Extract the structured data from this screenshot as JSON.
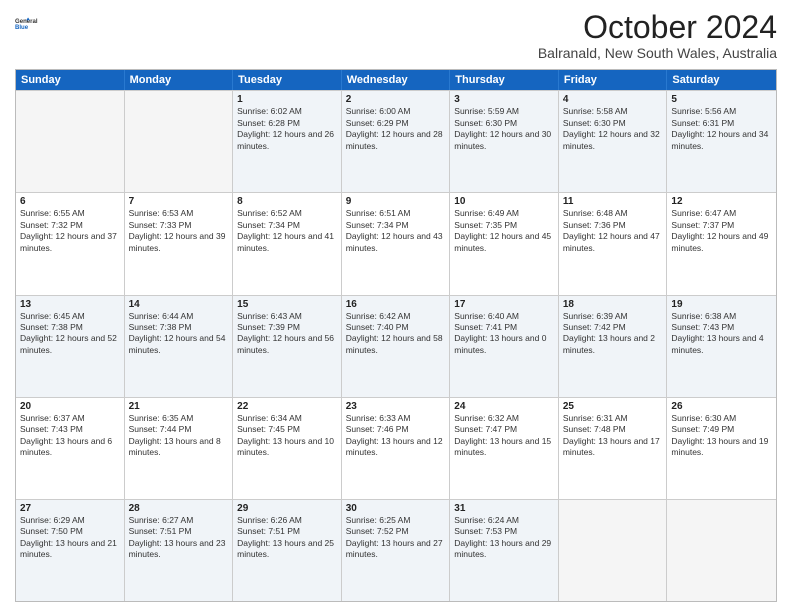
{
  "header": {
    "logo_line1": "General",
    "logo_line2": "Blue",
    "title": "October 2024",
    "subtitle": "Balranald, New South Wales, Australia"
  },
  "days": [
    "Sunday",
    "Monday",
    "Tuesday",
    "Wednesday",
    "Thursday",
    "Friday",
    "Saturday"
  ],
  "weeks": [
    [
      {
        "day": "",
        "sunrise": "",
        "sunset": "",
        "daylight": "",
        "empty": true
      },
      {
        "day": "",
        "sunrise": "",
        "sunset": "",
        "daylight": "",
        "empty": true
      },
      {
        "day": "1",
        "sunrise": "Sunrise: 6:02 AM",
        "sunset": "Sunset: 6:28 PM",
        "daylight": "Daylight: 12 hours and 26 minutes."
      },
      {
        "day": "2",
        "sunrise": "Sunrise: 6:00 AM",
        "sunset": "Sunset: 6:29 PM",
        "daylight": "Daylight: 12 hours and 28 minutes."
      },
      {
        "day": "3",
        "sunrise": "Sunrise: 5:59 AM",
        "sunset": "Sunset: 6:30 PM",
        "daylight": "Daylight: 12 hours and 30 minutes."
      },
      {
        "day": "4",
        "sunrise": "Sunrise: 5:58 AM",
        "sunset": "Sunset: 6:30 PM",
        "daylight": "Daylight: 12 hours and 32 minutes."
      },
      {
        "day": "5",
        "sunrise": "Sunrise: 5:56 AM",
        "sunset": "Sunset: 6:31 PM",
        "daylight": "Daylight: 12 hours and 34 minutes."
      }
    ],
    [
      {
        "day": "6",
        "sunrise": "Sunrise: 6:55 AM",
        "sunset": "Sunset: 7:32 PM",
        "daylight": "Daylight: 12 hours and 37 minutes."
      },
      {
        "day": "7",
        "sunrise": "Sunrise: 6:53 AM",
        "sunset": "Sunset: 7:33 PM",
        "daylight": "Daylight: 12 hours and 39 minutes."
      },
      {
        "day": "8",
        "sunrise": "Sunrise: 6:52 AM",
        "sunset": "Sunset: 7:34 PM",
        "daylight": "Daylight: 12 hours and 41 minutes."
      },
      {
        "day": "9",
        "sunrise": "Sunrise: 6:51 AM",
        "sunset": "Sunset: 7:34 PM",
        "daylight": "Daylight: 12 hours and 43 minutes."
      },
      {
        "day": "10",
        "sunrise": "Sunrise: 6:49 AM",
        "sunset": "Sunset: 7:35 PM",
        "daylight": "Daylight: 12 hours and 45 minutes."
      },
      {
        "day": "11",
        "sunrise": "Sunrise: 6:48 AM",
        "sunset": "Sunset: 7:36 PM",
        "daylight": "Daylight: 12 hours and 47 minutes."
      },
      {
        "day": "12",
        "sunrise": "Sunrise: 6:47 AM",
        "sunset": "Sunset: 7:37 PM",
        "daylight": "Daylight: 12 hours and 49 minutes."
      }
    ],
    [
      {
        "day": "13",
        "sunrise": "Sunrise: 6:45 AM",
        "sunset": "Sunset: 7:38 PM",
        "daylight": "Daylight: 12 hours and 52 minutes."
      },
      {
        "day": "14",
        "sunrise": "Sunrise: 6:44 AM",
        "sunset": "Sunset: 7:38 PM",
        "daylight": "Daylight: 12 hours and 54 minutes."
      },
      {
        "day": "15",
        "sunrise": "Sunrise: 6:43 AM",
        "sunset": "Sunset: 7:39 PM",
        "daylight": "Daylight: 12 hours and 56 minutes."
      },
      {
        "day": "16",
        "sunrise": "Sunrise: 6:42 AM",
        "sunset": "Sunset: 7:40 PM",
        "daylight": "Daylight: 12 hours and 58 minutes."
      },
      {
        "day": "17",
        "sunrise": "Sunrise: 6:40 AM",
        "sunset": "Sunset: 7:41 PM",
        "daylight": "Daylight: 13 hours and 0 minutes."
      },
      {
        "day": "18",
        "sunrise": "Sunrise: 6:39 AM",
        "sunset": "Sunset: 7:42 PM",
        "daylight": "Daylight: 13 hours and 2 minutes."
      },
      {
        "day": "19",
        "sunrise": "Sunrise: 6:38 AM",
        "sunset": "Sunset: 7:43 PM",
        "daylight": "Daylight: 13 hours and 4 minutes."
      }
    ],
    [
      {
        "day": "20",
        "sunrise": "Sunrise: 6:37 AM",
        "sunset": "Sunset: 7:43 PM",
        "daylight": "Daylight: 13 hours and 6 minutes."
      },
      {
        "day": "21",
        "sunrise": "Sunrise: 6:35 AM",
        "sunset": "Sunset: 7:44 PM",
        "daylight": "Daylight: 13 hours and 8 minutes."
      },
      {
        "day": "22",
        "sunrise": "Sunrise: 6:34 AM",
        "sunset": "Sunset: 7:45 PM",
        "daylight": "Daylight: 13 hours and 10 minutes."
      },
      {
        "day": "23",
        "sunrise": "Sunrise: 6:33 AM",
        "sunset": "Sunset: 7:46 PM",
        "daylight": "Daylight: 13 hours and 12 minutes."
      },
      {
        "day": "24",
        "sunrise": "Sunrise: 6:32 AM",
        "sunset": "Sunset: 7:47 PM",
        "daylight": "Daylight: 13 hours and 15 minutes."
      },
      {
        "day": "25",
        "sunrise": "Sunrise: 6:31 AM",
        "sunset": "Sunset: 7:48 PM",
        "daylight": "Daylight: 13 hours and 17 minutes."
      },
      {
        "day": "26",
        "sunrise": "Sunrise: 6:30 AM",
        "sunset": "Sunset: 7:49 PM",
        "daylight": "Daylight: 13 hours and 19 minutes."
      }
    ],
    [
      {
        "day": "27",
        "sunrise": "Sunrise: 6:29 AM",
        "sunset": "Sunset: 7:50 PM",
        "daylight": "Daylight: 13 hours and 21 minutes."
      },
      {
        "day": "28",
        "sunrise": "Sunrise: 6:27 AM",
        "sunset": "Sunset: 7:51 PM",
        "daylight": "Daylight: 13 hours and 23 minutes."
      },
      {
        "day": "29",
        "sunrise": "Sunrise: 6:26 AM",
        "sunset": "Sunset: 7:51 PM",
        "daylight": "Daylight: 13 hours and 25 minutes."
      },
      {
        "day": "30",
        "sunrise": "Sunrise: 6:25 AM",
        "sunset": "Sunset: 7:52 PM",
        "daylight": "Daylight: 13 hours and 27 minutes."
      },
      {
        "day": "31",
        "sunrise": "Sunrise: 6:24 AM",
        "sunset": "Sunset: 7:53 PM",
        "daylight": "Daylight: 13 hours and 29 minutes."
      },
      {
        "day": "",
        "sunrise": "",
        "sunset": "",
        "daylight": "",
        "empty": true
      },
      {
        "day": "",
        "sunrise": "",
        "sunset": "",
        "daylight": "",
        "empty": true
      }
    ]
  ]
}
